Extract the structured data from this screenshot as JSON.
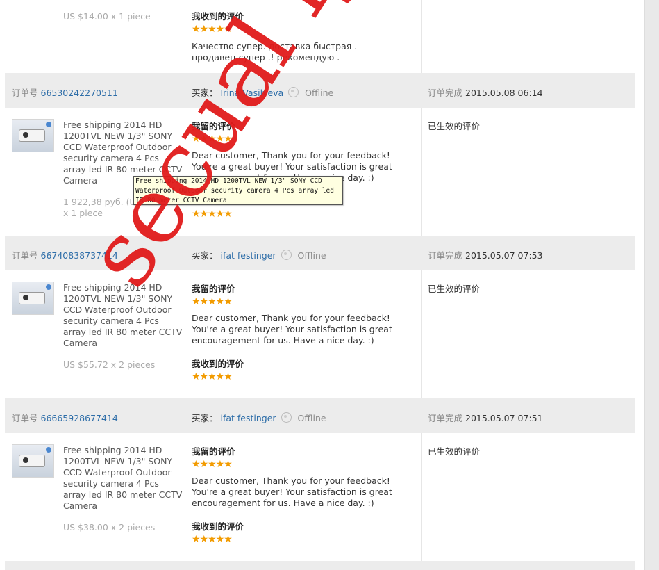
{
  "labels": {
    "order_no": "订单号",
    "buyer": "买家：",
    "order_done": "订单完成",
    "my_review": "我留的评价",
    "received_review": "我收到的评价",
    "effective_review": "已生效的评价",
    "offline": "Offline"
  },
  "top": {
    "price": "US $14.00 x 1 piece",
    "received_review_text": "Качество супер. доставка быстрая . продавец супер .! рекомендую ."
  },
  "orders": [
    {
      "order_id": "66530242270511",
      "buyer": "Irina Vasilyeva",
      "completed": "2015.05.08 06:14",
      "product": "Free shipping 2014 HD 1200TVL NEW 1/3\" SONY CCD Waterproof Outdoor security camera 4 Pcs array led IR 80 meter CCTV Camera",
      "price": "1 922,38 руб. (US",
      "qty": "x 1 piece",
      "my_review_text": "Dear customer, Thank you for your feedback! You're a great buyer! Your satisfaction is great encouragement for us. Have a nice day. :)"
    },
    {
      "order_id": "66740838737414",
      "buyer": "ifat festinger",
      "completed": "2015.05.07 07:53",
      "product": "Free shipping 2014 HD 1200TVL NEW 1/3\" SONY CCD Waterproof Outdoor security camera 4 Pcs array led IR 80 meter CCTV Camera",
      "price": "US $55.72 x 2 pieces",
      "my_review_text": "Dear customer, Thank you for your feedback! You're a great buyer! Your satisfaction is great encouragement for us. Have a nice day. :)"
    },
    {
      "order_id": "66665928677414",
      "buyer": "ifat festinger",
      "completed": "2015.05.07 07:51",
      "product": "Free shipping 2014 HD 1200TVL NEW 1/3\" SONY CCD Waterproof Outdoor security camera 4 Pcs array led IR 80 meter CCTV Camera",
      "price": "US $38.00 x 2 pieces",
      "my_review_text": "Dear customer, Thank you for your feedback! You're a great buyer! Your satisfaction is great encouragement for us. Have a nice day. :)"
    }
  ],
  "tooltip": "Free shipping 2014 HD 1200TVL NEW 1/3\" SONY CCD Waterproof Outdoor security camera 4 Pcs array led IR 80 meter CCTV Camera",
  "stars": "★★★★★",
  "watermark": "secual ly",
  "colors": {
    "link": "#2d6da8",
    "star": "#f29b00",
    "watermark": "#e11b1b",
    "header_bg": "#ececec"
  },
  "icons": {
    "buyer_status": "user-status-icon",
    "product": "camera-thumbnail"
  }
}
